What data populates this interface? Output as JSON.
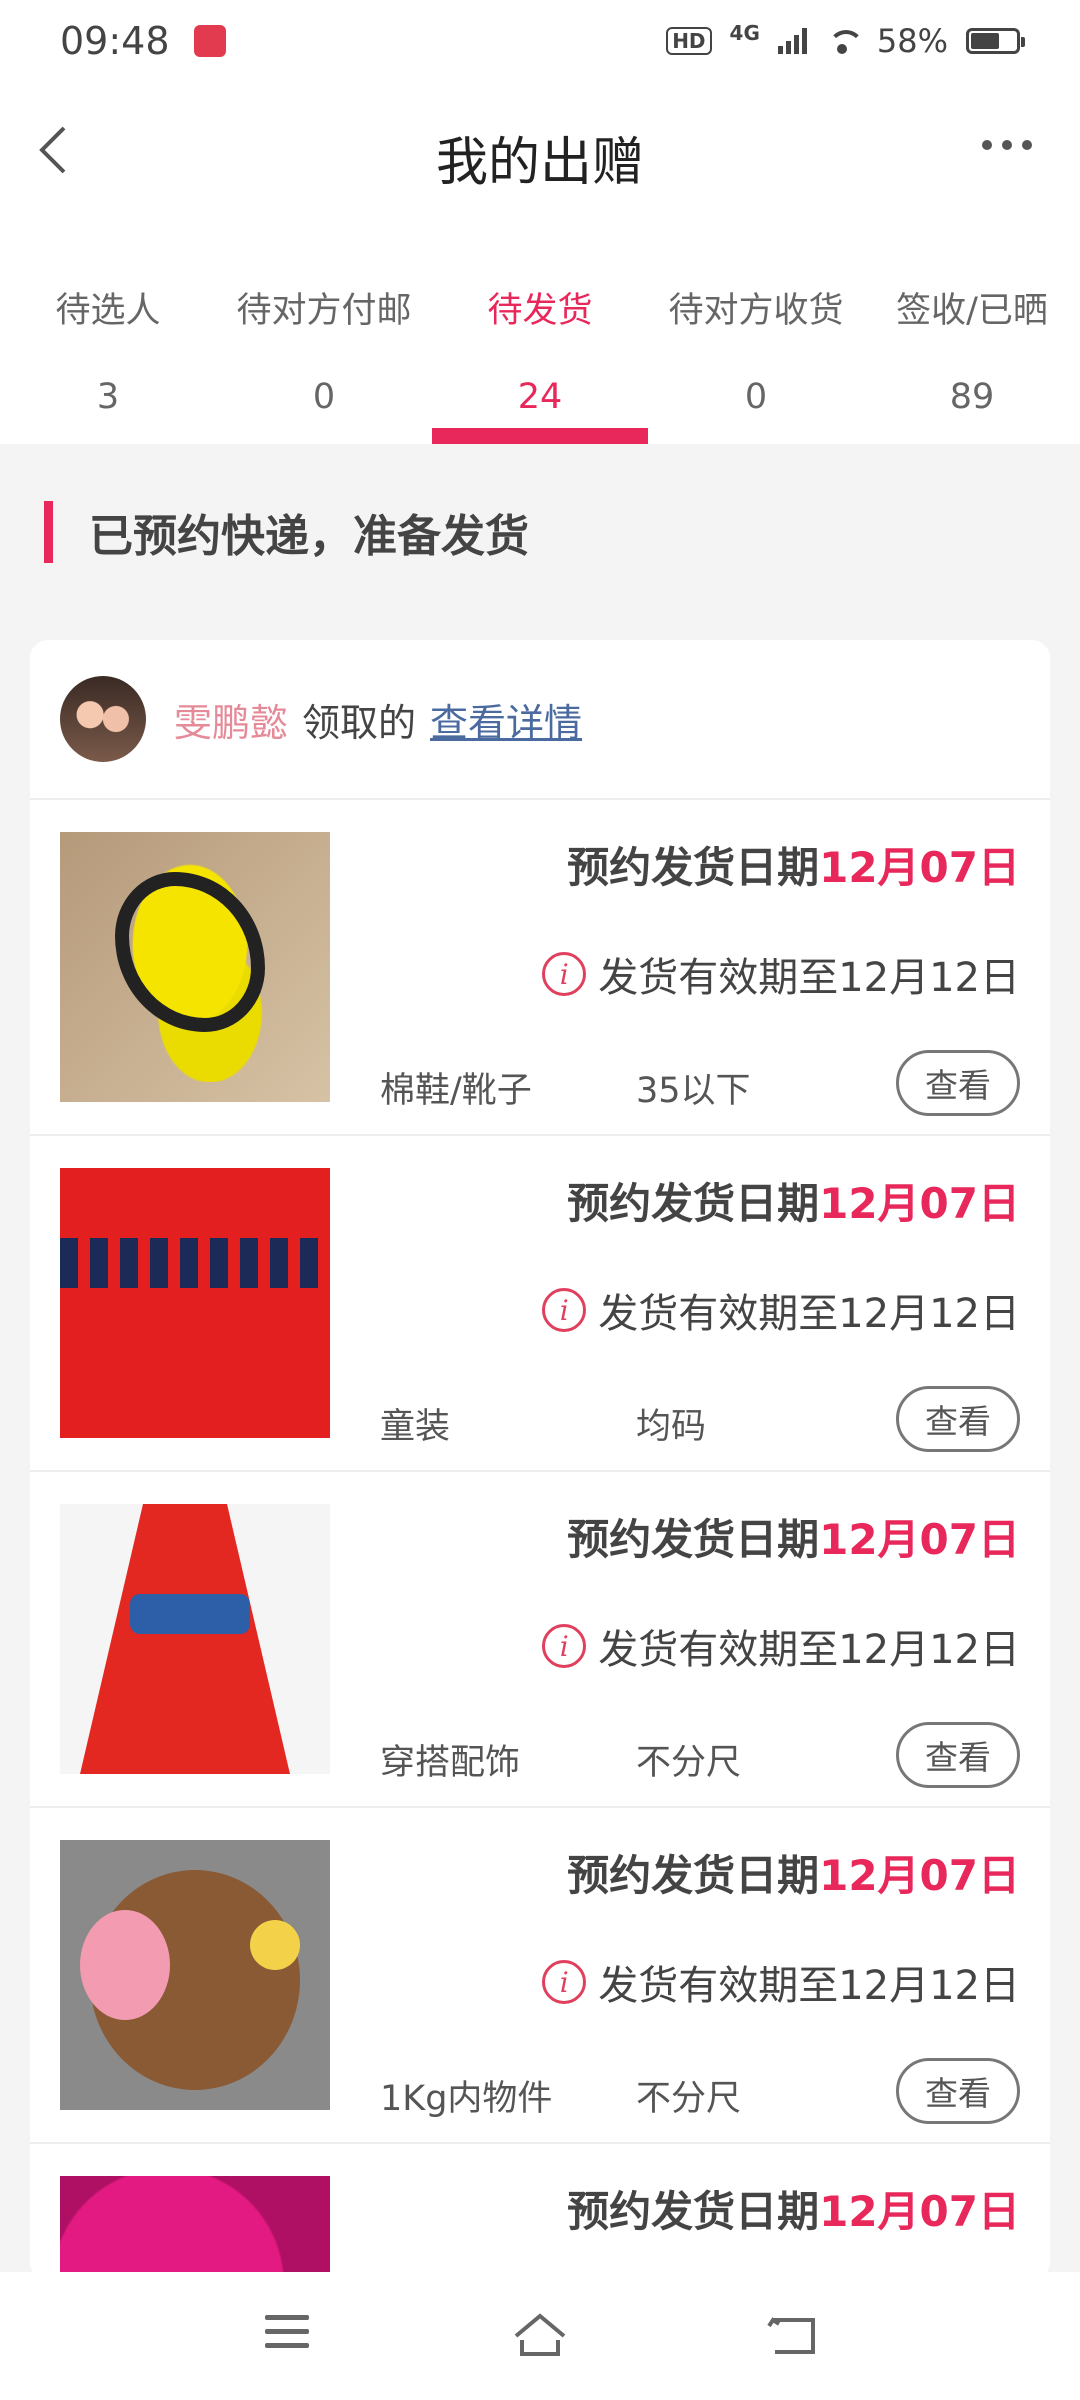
{
  "status_bar": {
    "time": "09:48",
    "hd": "HD",
    "network": "4G",
    "battery": "58%"
  },
  "header": {
    "title": "我的出赠"
  },
  "tabs": [
    {
      "label": "待选人",
      "count": "3"
    },
    {
      "label": "待对方付邮",
      "count": "0"
    },
    {
      "label": "待发货",
      "count": "24"
    },
    {
      "label": "待对方收货",
      "count": "0"
    },
    {
      "label": "签收/已晒",
      "count": "89"
    }
  ],
  "active_tab": 2,
  "section_title": "已预约快递，准备发货",
  "donor": {
    "name": "雯鹏懿",
    "text": "领取的",
    "link": "查看详情"
  },
  "items": [
    {
      "schedule_label": "预约发货日期",
      "schedule_date": "12月07日",
      "valid": "发货有效期至12月12日",
      "category": "棉鞋/靴子",
      "size": "35以下",
      "button": "查看"
    },
    {
      "schedule_label": "预约发货日期",
      "schedule_date": "12月07日",
      "valid": "发货有效期至12月12日",
      "category": "童装",
      "size": "均码",
      "button": "查看"
    },
    {
      "schedule_label": "预约发货日期",
      "schedule_date": "12月07日",
      "valid": "发货有效期至12月12日",
      "category": "穿搭配饰",
      "size": "不分尺",
      "button": "查看"
    },
    {
      "schedule_label": "预约发货日期",
      "schedule_date": "12月07日",
      "valid": "发货有效期至12月12日",
      "category": "1Kg内物件",
      "size": "不分尺",
      "button": "查看"
    },
    {
      "schedule_label": "预约发货日期",
      "schedule_date": "12月07日"
    }
  ],
  "colors": {
    "accent": "#e8285a",
    "link": "#4b6aa0",
    "donor_name": "#e58a99"
  }
}
